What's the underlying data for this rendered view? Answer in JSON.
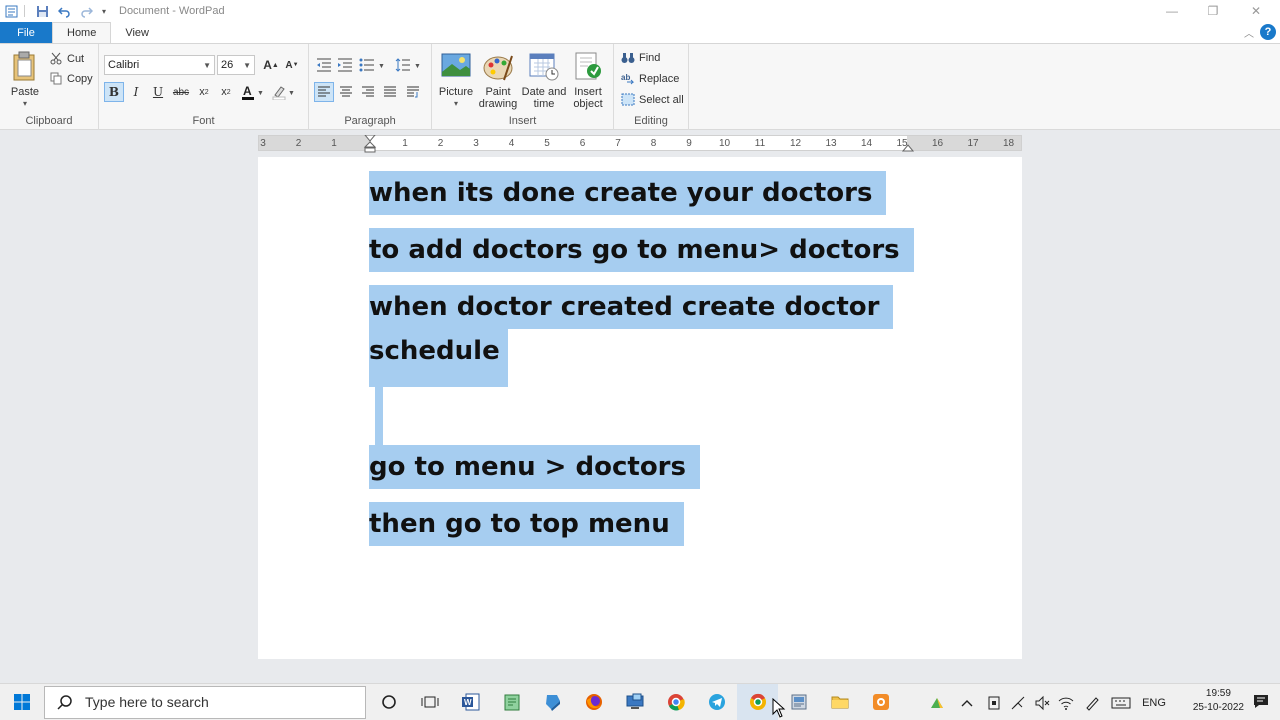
{
  "window": {
    "title": "Document - WordPad",
    "minimize": "—",
    "restore": "❐",
    "close": "✕"
  },
  "tabs": [
    {
      "label": "File"
    },
    {
      "label": "Home"
    },
    {
      "label": "View"
    }
  ],
  "help": "?",
  "ribbon": {
    "clipboard": {
      "label": "Clipboard",
      "paste": "Paste",
      "cut": "Cut",
      "copy": "Copy"
    },
    "font": {
      "label": "Font",
      "family": "Calibri",
      "size": "26"
    },
    "paragraph": {
      "label": "Paragraph"
    },
    "insert": {
      "label": "Insert",
      "picture": "Picture",
      "paint_1": "Paint",
      "paint_2": "drawing",
      "date_1": "Date and",
      "date_2": "time",
      "object_1": "Insert",
      "object_2": "object"
    },
    "editing": {
      "label": "Editing",
      "find": "Find",
      "replace": "Replace",
      "select_all": "Select all"
    }
  },
  "ruler": {
    "ticks": [
      "3",
      "2",
      "1",
      "1",
      "2",
      "3",
      "4",
      "5",
      "6",
      "7",
      "8",
      "9",
      "10",
      "11",
      "12",
      "13",
      "14",
      "15",
      "16",
      "17",
      "18"
    ]
  },
  "document": {
    "lines": [
      "when its done create your doctors",
      "to add doctors go to menu> doctors",
      "when doctor created create doctor",
      "schedule",
      "go to menu > doctors",
      "then go to top menu"
    ]
  },
  "taskbar": {
    "search_placeholder": "Type here to search",
    "language": "ENG",
    "time": "19:59",
    "date": "25-10-2022"
  },
  "colors": {
    "accent": "#1979ca",
    "selection": "#a6cdf0",
    "ribbon_bg": "#f7f7f7"
  }
}
